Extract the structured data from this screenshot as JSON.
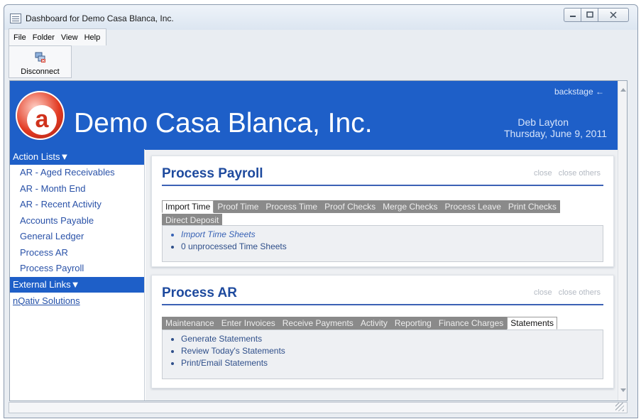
{
  "window": {
    "title": "Dashboard for Demo Casa Blanca, Inc.",
    "min_icon": "minimize-icon",
    "max_icon": "maximize-icon",
    "close_icon": "close-icon"
  },
  "menu": {
    "items": [
      "File",
      "Folder",
      "View",
      "Help"
    ]
  },
  "toolbar": {
    "disconnect_label": "Disconnect",
    "disconnect_icon": "disconnect-icon"
  },
  "banner": {
    "company": "Demo Casa Blanca, Inc.",
    "backstage": "backstage ←",
    "user": "Deb Layton",
    "date": "Thursday, June 9, 2011",
    "logo_letter": "a",
    "bg_color": "#1e5fc8",
    "logo_color": "#e23a22"
  },
  "sidebar": {
    "action_lists_label": "Action Lists▼",
    "action_items": [
      "AR - Aged Receivables",
      "AR - Month End",
      "AR - Recent Activity",
      "Accounts Payable",
      "General Ledger",
      "Process AR",
      "Process Payroll"
    ],
    "external_links_label": "External Links▼",
    "external_items": [
      "nQativ Solutions"
    ]
  },
  "panels": {
    "payroll": {
      "title": "Process Payroll",
      "close": "close",
      "close_others": "close others",
      "tabs": [
        "Import Time",
        "Proof Time",
        "Process Time",
        "Proof Checks",
        "Merge Checks",
        "Process Leave",
        "Print Checks",
        "Direct Deposit"
      ],
      "active_tab": "Import Time",
      "items": [
        "Import Time Sheets",
        "0 unprocessed Time Sheets"
      ]
    },
    "ar": {
      "title": "Process AR",
      "close": "close",
      "close_others": "close others",
      "tabs": [
        "Maintenance",
        "Enter Invoices",
        "Receive Payments",
        "Activity",
        "Reporting",
        "Finance Charges",
        "Statements"
      ],
      "active_tab": "Statements",
      "items": [
        "Generate Statements",
        "Review Today's Statements",
        "Print/Email Statements"
      ]
    }
  }
}
